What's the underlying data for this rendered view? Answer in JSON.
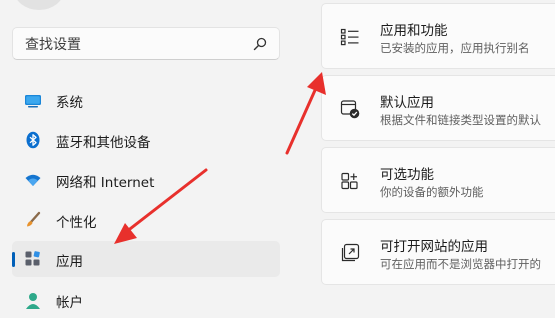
{
  "search": {
    "placeholder": "查找设置",
    "icon": "search-icon"
  },
  "sidebar": {
    "items": [
      {
        "label": "系统",
        "icon": "monitor-icon"
      },
      {
        "label": "蓝牙和其他设备",
        "icon": "bluetooth-icon"
      },
      {
        "label": "网络和 Internet",
        "icon": "wifi-icon"
      },
      {
        "label": "个性化",
        "icon": "paintbrush-icon"
      },
      {
        "label": "应用",
        "icon": "apps-icon",
        "selected": true
      },
      {
        "label": "帐户",
        "icon": "account-icon"
      }
    ]
  },
  "main": {
    "cards": [
      {
        "title": "应用和功能",
        "subtitle": "已安装的应用，应用执行别名",
        "icon": "list-icon"
      },
      {
        "title": "默认应用",
        "subtitle": "根据文件和链接类型设置的默认",
        "icon": "default-apps-icon"
      },
      {
        "title": "可选功能",
        "subtitle": "你的设备的额外功能",
        "icon": "optional-features-icon"
      },
      {
        "title": "可打开网站的应用",
        "subtitle": "可在应用而不是浏览器中打开的",
        "icon": "open-web-icon"
      }
    ]
  },
  "colors": {
    "accent": "#005fb8",
    "annotation_arrow": "#e8302c"
  }
}
